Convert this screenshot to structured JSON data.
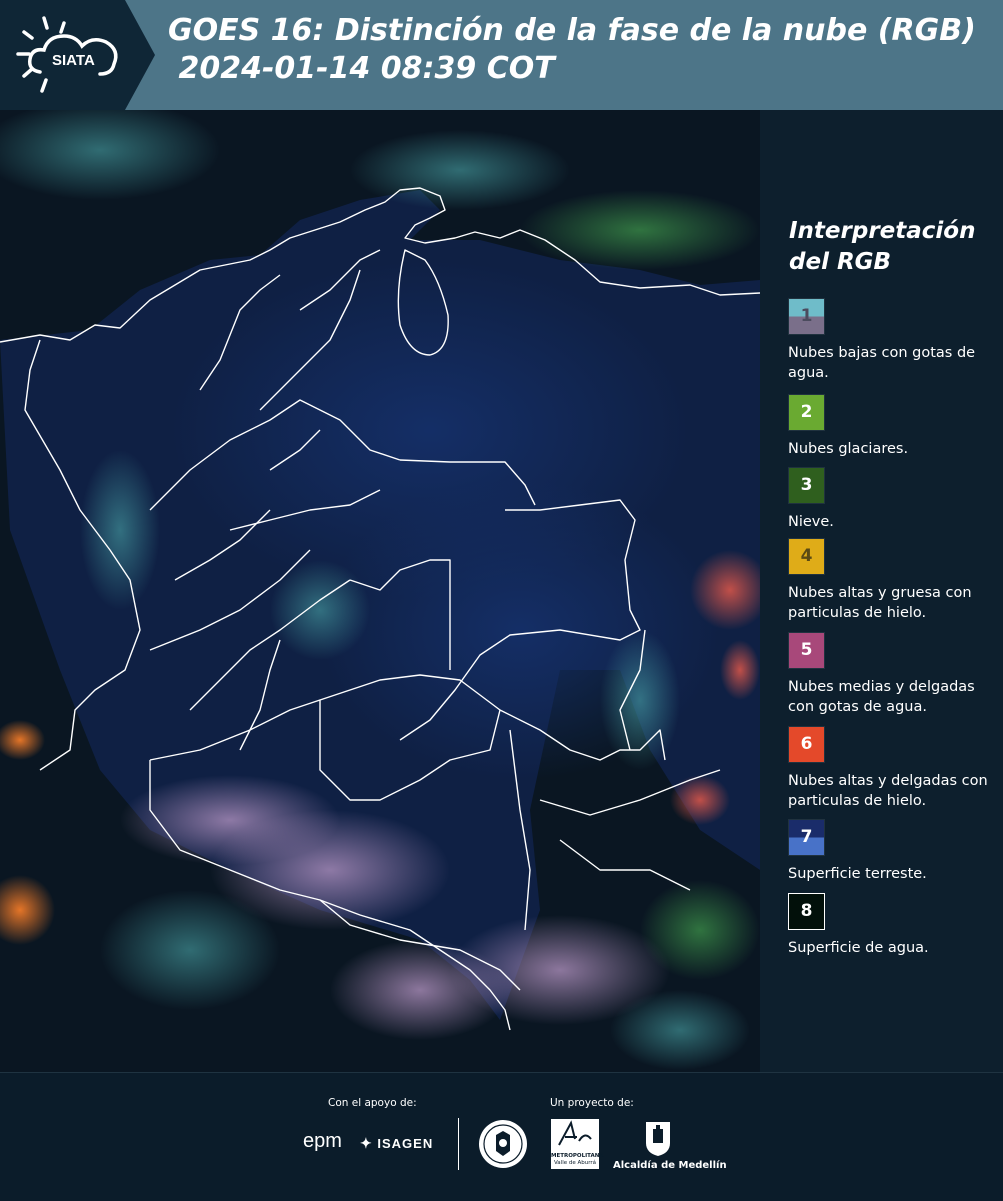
{
  "header": {
    "logo_text": "SIATA",
    "title_line1": "GOES 16: Distinción de la fase de la nube (RGB)",
    "title_line2": " 2024-01-14 08:39 COT"
  },
  "legend": {
    "title": "Interpretación del RGB",
    "items": [
      {
        "number": "1",
        "label": "Nubes bajas con gotas de agua.",
        "colors": [
          "#6fbcc9",
          "#7a6f8a"
        ]
      },
      {
        "number": "2",
        "label": "Nubes glaciares.",
        "colors": [
          "#6aaa31"
        ]
      },
      {
        "number": "3",
        "label": "Nieve.",
        "colors": [
          "#2f5f1e"
        ]
      },
      {
        "number": "4",
        "label": "Nubes altas y gruesa con particulas de hielo.",
        "colors": [
          "#dfac18"
        ]
      },
      {
        "number": "5",
        "label": "Nubes medias y delgadas con gotas de agua.",
        "colors": [
          "#a8487a"
        ]
      },
      {
        "number": "6",
        "label": "Nubes altas y delgadas con particulas de hielo.",
        "colors": [
          "#e4492a"
        ]
      },
      {
        "number": "7",
        "label": "Superficie terreste.",
        "colors": [
          "#1a2c6a",
          "#4872c8"
        ]
      },
      {
        "number": "8",
        "label": "Superficie de agua.",
        "colors": [
          "#02100a"
        ]
      }
    ]
  },
  "footer": {
    "support_label": "Con el apoyo de:",
    "project_label": "Un proyecto de:",
    "sponsor1": "epm",
    "sponsor2": "ISAGEN",
    "partner1_line1": "METROPOLITANA",
    "partner1_line2": "Valle de Aburrá",
    "partner2": "Alcaldía de Medellín"
  }
}
